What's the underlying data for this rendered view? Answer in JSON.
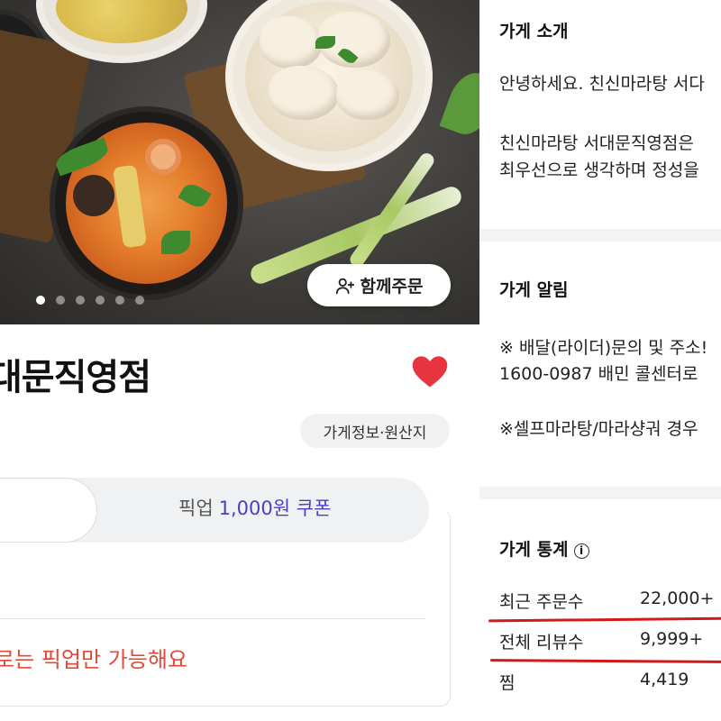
{
  "store": {
    "name_partial": "대문직영점",
    "info_chip": "가게정보·원산지",
    "together_order": "함께주문",
    "carousel_count": 6,
    "carousel_active": 0
  },
  "order": {
    "pickup_label": "픽업",
    "pickup_coupon": "1,000원 쿠폰",
    "pickup_only_notice": "로는 픽업만 가능해요"
  },
  "intro": {
    "title": "가게 소개",
    "line1": "안녕하세요. 친신마라탕 서다",
    "line2": "친신마라탕 서대문직영점은",
    "line3": "최우선으로 생각하며 정성을"
  },
  "notice": {
    "title": "가게 알림",
    "line1": "※ 배달(라이더)문의 및 주소!",
    "line2": "1600-0987 배민 콜센터로",
    "line3": "※셀프마라탕/마라샹궈 경우"
  },
  "stats": {
    "title": "가게 통계",
    "rows": [
      {
        "label": "최근 주문수",
        "value": "22,000+"
      },
      {
        "label": "전체 리뷰수",
        "value": "9,999+"
      },
      {
        "label": "찜",
        "value": "4,419"
      }
    ]
  },
  "colors": {
    "heart": "#e8343f",
    "coupon": "#4a3fc4",
    "notice_red": "#e04a3a",
    "underline": "#d11b1b"
  },
  "icons": {
    "together": "person-add-icon",
    "favorite": "heart-icon",
    "stats_info": "info-icon"
  }
}
